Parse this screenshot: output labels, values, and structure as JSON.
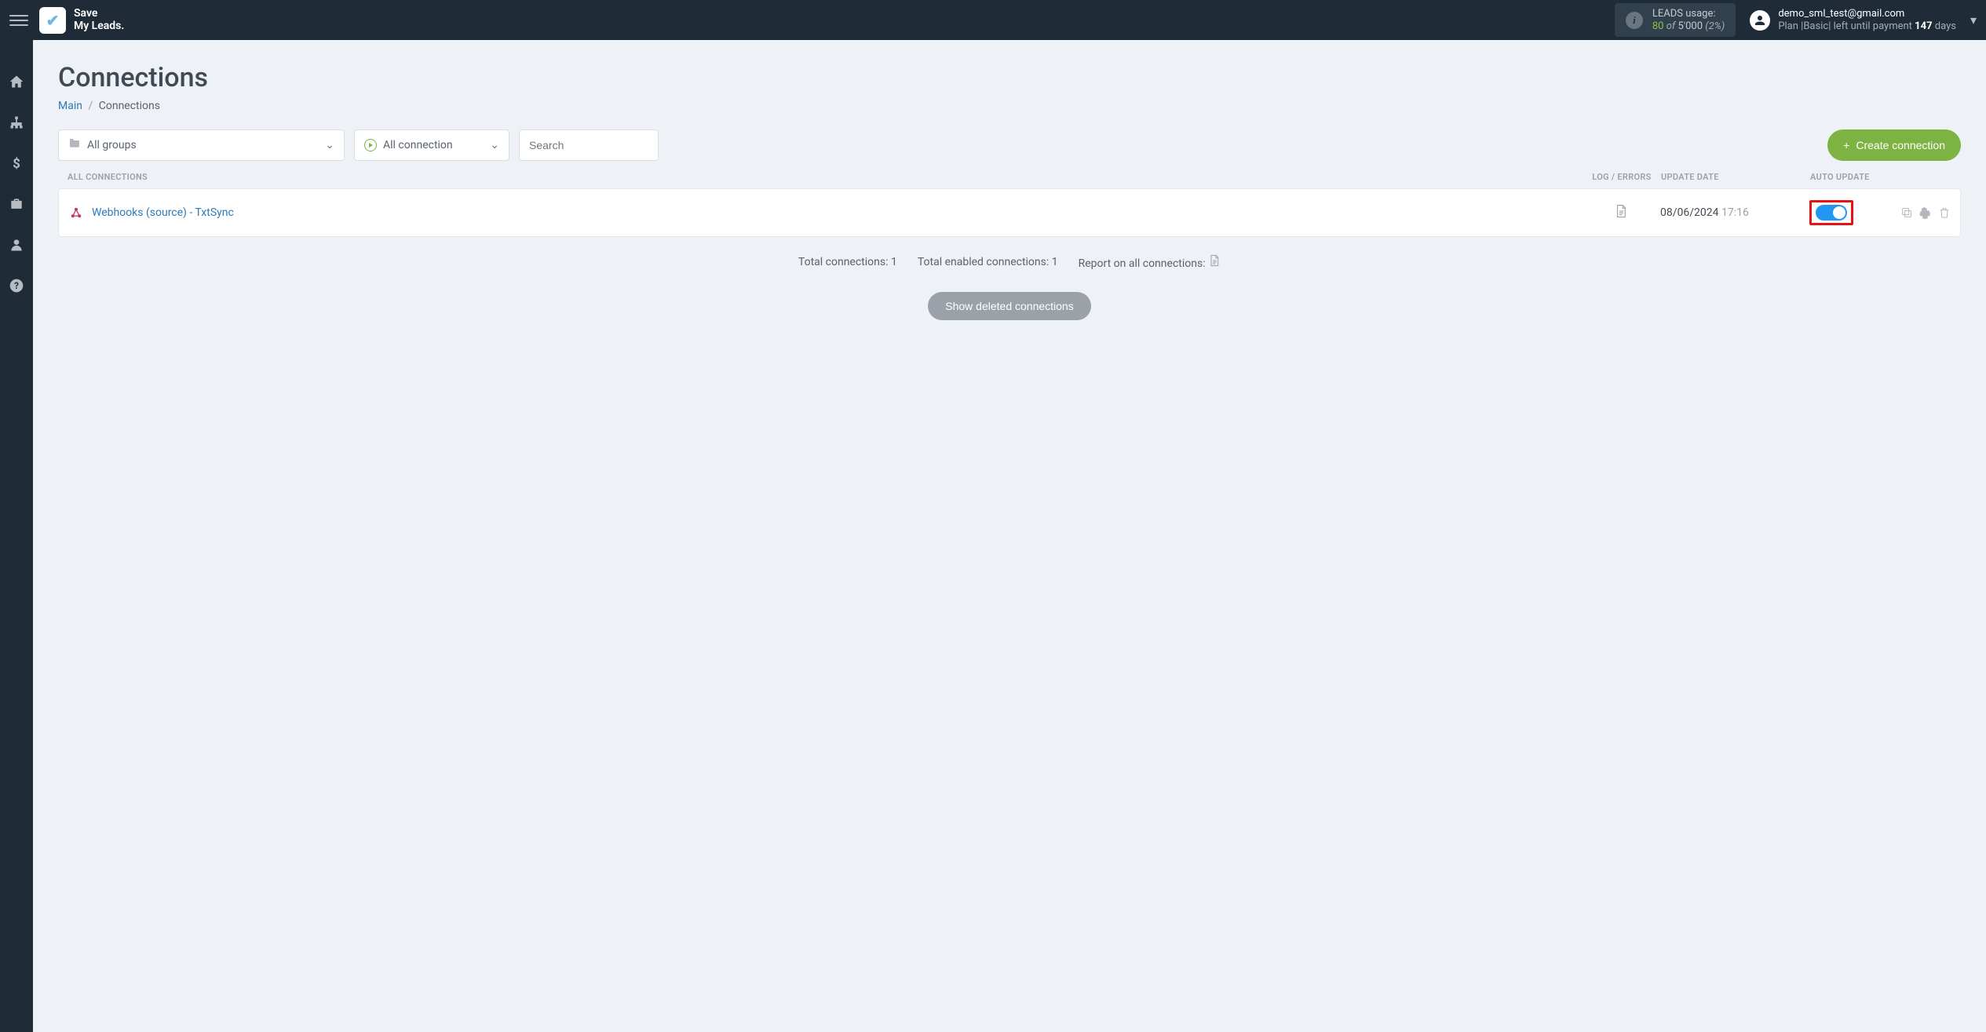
{
  "brand": {
    "line1": "Save",
    "line2": "My Leads."
  },
  "leads_usage": {
    "label": "LEADS usage:",
    "used": "80",
    "of_word": "of",
    "total": "5'000",
    "pct": "(2%)"
  },
  "user": {
    "email": "demo_sml_test@gmail.com",
    "plan_prefix": "Plan |",
    "plan_name": "Basic",
    "plan_mid": "| left until payment ",
    "plan_days": "147",
    "plan_suffix": " days"
  },
  "page": {
    "title": "Connections",
    "breadcrumb_main": "Main",
    "breadcrumb_sep": "/",
    "breadcrumb_current": "Connections"
  },
  "filters": {
    "groups_label": "All groups",
    "connection_label": "All connection",
    "search_placeholder": "Search",
    "create_btn": "Create connection"
  },
  "table": {
    "col_name": "ALL CONNECTIONS",
    "col_log": "LOG / ERRORS",
    "col_date": "UPDATE DATE",
    "col_auto": "AUTO UPDATE",
    "rows": [
      {
        "name": "Webhooks (source) - TxtSync",
        "date": "08/06/2024",
        "time": "17:16",
        "auto_on": true
      }
    ]
  },
  "summary": {
    "total_label": "Total connections: ",
    "total_value": "1",
    "enabled_label": "Total enabled connections: ",
    "enabled_value": "1",
    "report_label": "Report on all connections: "
  },
  "show_deleted": "Show deleted connections"
}
